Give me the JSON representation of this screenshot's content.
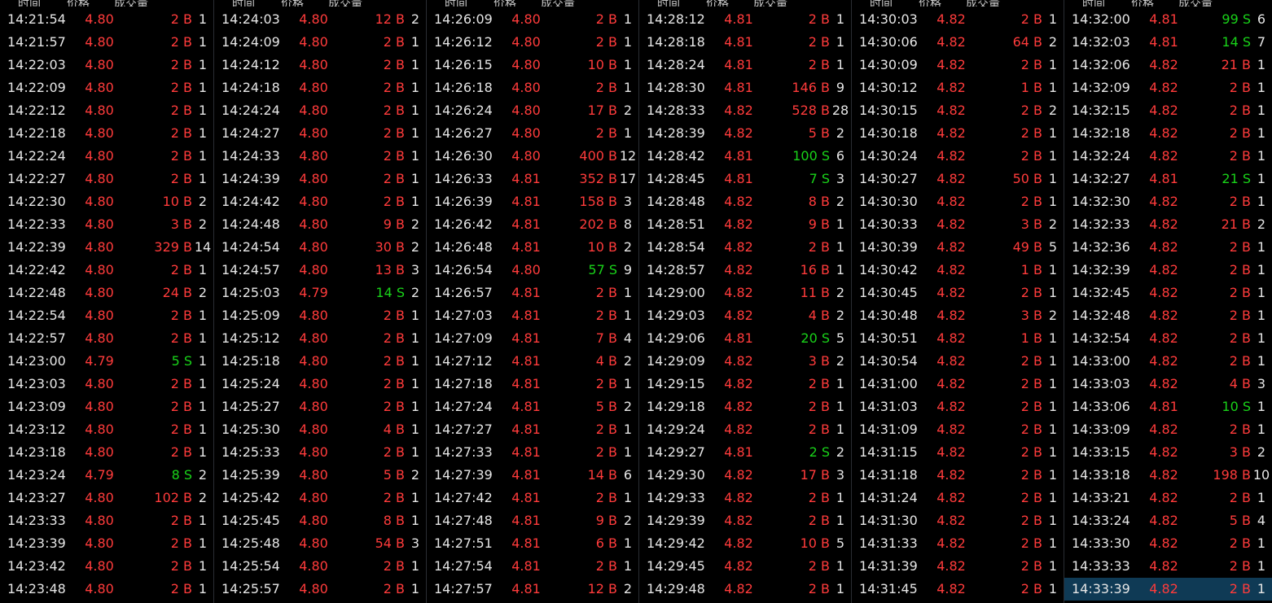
{
  "colors": {
    "buy": "#ff3b3b",
    "sell": "#19d219",
    "text": "#e6e6e6",
    "background": "#000000",
    "selected_row": "#0f3a55"
  },
  "headers": {
    "time": "时间",
    "price": "价格",
    "volume": "成交量"
  },
  "columns": [
    {
      "rows": [
        [
          "14:21:54",
          "4.80",
          "2 B",
          "1"
        ],
        [
          "14:21:57",
          "4.80",
          "2 B",
          "1"
        ],
        [
          "14:22:03",
          "4.80",
          "2 B",
          "1"
        ],
        [
          "14:22:09",
          "4.80",
          "2 B",
          "1"
        ],
        [
          "14:22:12",
          "4.80",
          "2 B",
          "1"
        ],
        [
          "14:22:18",
          "4.80",
          "2 B",
          "1"
        ],
        [
          "14:22:24",
          "4.80",
          "2 B",
          "1"
        ],
        [
          "14:22:27",
          "4.80",
          "2 B",
          "1"
        ],
        [
          "14:22:30",
          "4.80",
          "10 B",
          "2"
        ],
        [
          "14:22:33",
          "4.80",
          "3 B",
          "2"
        ],
        [
          "14:22:39",
          "4.80",
          "329 B",
          "14"
        ],
        [
          "14:22:42",
          "4.80",
          "2 B",
          "1"
        ],
        [
          "14:22:48",
          "4.80",
          "24 B",
          "2"
        ],
        [
          "14:22:54",
          "4.80",
          "2 B",
          "1"
        ],
        [
          "14:22:57",
          "4.80",
          "2 B",
          "1"
        ],
        [
          "14:23:00",
          "4.79",
          "5 S",
          "1"
        ],
        [
          "14:23:03",
          "4.80",
          "2 B",
          "1"
        ],
        [
          "14:23:09",
          "4.80",
          "2 B",
          "1"
        ],
        [
          "14:23:12",
          "4.80",
          "2 B",
          "1"
        ],
        [
          "14:23:18",
          "4.80",
          "2 B",
          "1"
        ],
        [
          "14:23:24",
          "4.79",
          "8 S",
          "2"
        ],
        [
          "14:23:27",
          "4.80",
          "102 B",
          "2"
        ],
        [
          "14:23:33",
          "4.80",
          "2 B",
          "1"
        ],
        [
          "14:23:39",
          "4.80",
          "2 B",
          "1"
        ],
        [
          "14:23:42",
          "4.80",
          "2 B",
          "1"
        ],
        [
          "14:23:48",
          "4.80",
          "2 B",
          "1"
        ]
      ]
    },
    {
      "rows": [
        [
          "14:24:03",
          "4.80",
          "12 B",
          "2"
        ],
        [
          "14:24:09",
          "4.80",
          "2 B",
          "1"
        ],
        [
          "14:24:12",
          "4.80",
          "2 B",
          "1"
        ],
        [
          "14:24:18",
          "4.80",
          "2 B",
          "1"
        ],
        [
          "14:24:24",
          "4.80",
          "2 B",
          "1"
        ],
        [
          "14:24:27",
          "4.80",
          "2 B",
          "1"
        ],
        [
          "14:24:33",
          "4.80",
          "2 B",
          "1"
        ],
        [
          "14:24:39",
          "4.80",
          "2 B",
          "1"
        ],
        [
          "14:24:42",
          "4.80",
          "2 B",
          "1"
        ],
        [
          "14:24:48",
          "4.80",
          "9 B",
          "2"
        ],
        [
          "14:24:54",
          "4.80",
          "30 B",
          "2"
        ],
        [
          "14:24:57",
          "4.80",
          "13 B",
          "3"
        ],
        [
          "14:25:03",
          "4.79",
          "14 S",
          "2"
        ],
        [
          "14:25:09",
          "4.80",
          "2 B",
          "1"
        ],
        [
          "14:25:12",
          "4.80",
          "2 B",
          "1"
        ],
        [
          "14:25:18",
          "4.80",
          "2 B",
          "1"
        ],
        [
          "14:25:24",
          "4.80",
          "2 B",
          "1"
        ],
        [
          "14:25:27",
          "4.80",
          "2 B",
          "1"
        ],
        [
          "14:25:30",
          "4.80",
          "4 B",
          "1"
        ],
        [
          "14:25:33",
          "4.80",
          "2 B",
          "1"
        ],
        [
          "14:25:39",
          "4.80",
          "5 B",
          "2"
        ],
        [
          "14:25:42",
          "4.80",
          "2 B",
          "1"
        ],
        [
          "14:25:45",
          "4.80",
          "8 B",
          "1"
        ],
        [
          "14:25:48",
          "4.80",
          "54 B",
          "3"
        ],
        [
          "14:25:54",
          "4.80",
          "2 B",
          "1"
        ],
        [
          "14:25:57",
          "4.80",
          "2 B",
          "1"
        ]
      ]
    },
    {
      "rows": [
        [
          "14:26:09",
          "4.80",
          "2 B",
          "1"
        ],
        [
          "14:26:12",
          "4.80",
          "2 B",
          "1"
        ],
        [
          "14:26:15",
          "4.80",
          "10 B",
          "1"
        ],
        [
          "14:26:18",
          "4.80",
          "2 B",
          "1"
        ],
        [
          "14:26:24",
          "4.80",
          "17 B",
          "2"
        ],
        [
          "14:26:27",
          "4.80",
          "2 B",
          "1"
        ],
        [
          "14:26:30",
          "4.80",
          "400 B",
          "12"
        ],
        [
          "14:26:33",
          "4.81",
          "352 B",
          "17"
        ],
        [
          "14:26:39",
          "4.81",
          "158 B",
          "3"
        ],
        [
          "14:26:42",
          "4.81",
          "202 B",
          "8"
        ],
        [
          "14:26:48",
          "4.81",
          "10 B",
          "2"
        ],
        [
          "14:26:54",
          "4.80",
          "57 S",
          "9"
        ],
        [
          "14:26:57",
          "4.81",
          "2 B",
          "1"
        ],
        [
          "14:27:03",
          "4.81",
          "2 B",
          "1"
        ],
        [
          "14:27:09",
          "4.81",
          "7 B",
          "4"
        ],
        [
          "14:27:12",
          "4.81",
          "4 B",
          "2"
        ],
        [
          "14:27:18",
          "4.81",
          "2 B",
          "1"
        ],
        [
          "14:27:24",
          "4.81",
          "5 B",
          "2"
        ],
        [
          "14:27:27",
          "4.81",
          "2 B",
          "1"
        ],
        [
          "14:27:33",
          "4.81",
          "2 B",
          "1"
        ],
        [
          "14:27:39",
          "4.81",
          "14 B",
          "6"
        ],
        [
          "14:27:42",
          "4.81",
          "2 B",
          "1"
        ],
        [
          "14:27:48",
          "4.81",
          "9 B",
          "2"
        ],
        [
          "14:27:51",
          "4.81",
          "6 B",
          "1"
        ],
        [
          "14:27:54",
          "4.81",
          "2 B",
          "1"
        ],
        [
          "14:27:57",
          "4.81",
          "12 B",
          "2"
        ]
      ]
    },
    {
      "rows": [
        [
          "14:28:12",
          "4.81",
          "2 B",
          "1"
        ],
        [
          "14:28:18",
          "4.81",
          "2 B",
          "1"
        ],
        [
          "14:28:24",
          "4.81",
          "2 B",
          "1"
        ],
        [
          "14:28:30",
          "4.81",
          "146 B",
          "9"
        ],
        [
          "14:28:33",
          "4.82",
          "528 B",
          "28"
        ],
        [
          "14:28:39",
          "4.82",
          "5 B",
          "2"
        ],
        [
          "14:28:42",
          "4.81",
          "100 S",
          "6"
        ],
        [
          "14:28:45",
          "4.81",
          "7 S",
          "3"
        ],
        [
          "14:28:48",
          "4.82",
          "8 B",
          "2"
        ],
        [
          "14:28:51",
          "4.82",
          "9 B",
          "1"
        ],
        [
          "14:28:54",
          "4.82",
          "2 B",
          "1"
        ],
        [
          "14:28:57",
          "4.82",
          "16 B",
          "1"
        ],
        [
          "14:29:00",
          "4.82",
          "11 B",
          "2"
        ],
        [
          "14:29:03",
          "4.82",
          "4 B",
          "2"
        ],
        [
          "14:29:06",
          "4.81",
          "20 S",
          "5"
        ],
        [
          "14:29:09",
          "4.82",
          "3 B",
          "2"
        ],
        [
          "14:29:15",
          "4.82",
          "2 B",
          "1"
        ],
        [
          "14:29:18",
          "4.82",
          "2 B",
          "1"
        ],
        [
          "14:29:24",
          "4.82",
          "2 B",
          "1"
        ],
        [
          "14:29:27",
          "4.81",
          "2 S",
          "2"
        ],
        [
          "14:29:30",
          "4.82",
          "17 B",
          "3"
        ],
        [
          "14:29:33",
          "4.82",
          "2 B",
          "1"
        ],
        [
          "14:29:39",
          "4.82",
          "2 B",
          "1"
        ],
        [
          "14:29:42",
          "4.82",
          "10 B",
          "5"
        ],
        [
          "14:29:45",
          "4.82",
          "2 B",
          "1"
        ],
        [
          "14:29:48",
          "4.82",
          "2 B",
          "1"
        ]
      ]
    },
    {
      "rows": [
        [
          "14:30:03",
          "4.82",
          "2 B",
          "1"
        ],
        [
          "14:30:06",
          "4.82",
          "64 B",
          "2"
        ],
        [
          "14:30:09",
          "4.82",
          "2 B",
          "1"
        ],
        [
          "14:30:12",
          "4.82",
          "1 B",
          "1"
        ],
        [
          "14:30:15",
          "4.82",
          "2 B",
          "2"
        ],
        [
          "14:30:18",
          "4.82",
          "2 B",
          "1"
        ],
        [
          "14:30:24",
          "4.82",
          "2 B",
          "1"
        ],
        [
          "14:30:27",
          "4.82",
          "50 B",
          "1"
        ],
        [
          "14:30:30",
          "4.82",
          "2 B",
          "1"
        ],
        [
          "14:30:33",
          "4.82",
          "3 B",
          "2"
        ],
        [
          "14:30:39",
          "4.82",
          "49 B",
          "5"
        ],
        [
          "14:30:42",
          "4.82",
          "1 B",
          "1"
        ],
        [
          "14:30:45",
          "4.82",
          "2 B",
          "1"
        ],
        [
          "14:30:48",
          "4.82",
          "3 B",
          "2"
        ],
        [
          "14:30:51",
          "4.82",
          "1 B",
          "1"
        ],
        [
          "14:30:54",
          "4.82",
          "2 B",
          "1"
        ],
        [
          "14:31:00",
          "4.82",
          "2 B",
          "1"
        ],
        [
          "14:31:03",
          "4.82",
          "2 B",
          "1"
        ],
        [
          "14:31:09",
          "4.82",
          "2 B",
          "1"
        ],
        [
          "14:31:15",
          "4.82",
          "2 B",
          "1"
        ],
        [
          "14:31:18",
          "4.82",
          "2 B",
          "1"
        ],
        [
          "14:31:24",
          "4.82",
          "2 B",
          "1"
        ],
        [
          "14:31:30",
          "4.82",
          "2 B",
          "1"
        ],
        [
          "14:31:33",
          "4.82",
          "2 B",
          "1"
        ],
        [
          "14:31:39",
          "4.82",
          "2 B",
          "1"
        ],
        [
          "14:31:45",
          "4.82",
          "2 B",
          "1"
        ]
      ]
    },
    {
      "rows": [
        [
          "14:32:00",
          "4.81",
          "99 S",
          "6"
        ],
        [
          "14:32:03",
          "4.81",
          "14 S",
          "7"
        ],
        [
          "14:32:06",
          "4.82",
          "21 B",
          "1"
        ],
        [
          "14:32:09",
          "4.82",
          "2 B",
          "1"
        ],
        [
          "14:32:15",
          "4.82",
          "2 B",
          "1"
        ],
        [
          "14:32:18",
          "4.82",
          "2 B",
          "1"
        ],
        [
          "14:32:24",
          "4.82",
          "2 B",
          "1"
        ],
        [
          "14:32:27",
          "4.81",
          "21 S",
          "1"
        ],
        [
          "14:32:30",
          "4.82",
          "2 B",
          "1"
        ],
        [
          "14:32:33",
          "4.82",
          "21 B",
          "2"
        ],
        [
          "14:32:36",
          "4.82",
          "2 B",
          "1"
        ],
        [
          "14:32:39",
          "4.82",
          "2 B",
          "1"
        ],
        [
          "14:32:45",
          "4.82",
          "2 B",
          "1"
        ],
        [
          "14:32:48",
          "4.82",
          "2 B",
          "1"
        ],
        [
          "14:32:54",
          "4.82",
          "2 B",
          "1"
        ],
        [
          "14:33:00",
          "4.82",
          "2 B",
          "1"
        ],
        [
          "14:33:03",
          "4.82",
          "4 B",
          "3"
        ],
        [
          "14:33:06",
          "4.81",
          "10 S",
          "1"
        ],
        [
          "14:33:09",
          "4.82",
          "2 B",
          "1"
        ],
        [
          "14:33:15",
          "4.82",
          "3 B",
          "2"
        ],
        [
          "14:33:18",
          "4.82",
          "198 B",
          "10"
        ],
        [
          "14:33:21",
          "4.82",
          "2 B",
          "1"
        ],
        [
          "14:33:24",
          "4.82",
          "5 B",
          "4"
        ],
        [
          "14:33:30",
          "4.82",
          "2 B",
          "1"
        ],
        [
          "14:33:33",
          "4.82",
          "2 B",
          "1"
        ],
        [
          "14:33:39",
          "4.82",
          "2 B",
          "1"
        ]
      ],
      "selected_row": 25
    }
  ]
}
